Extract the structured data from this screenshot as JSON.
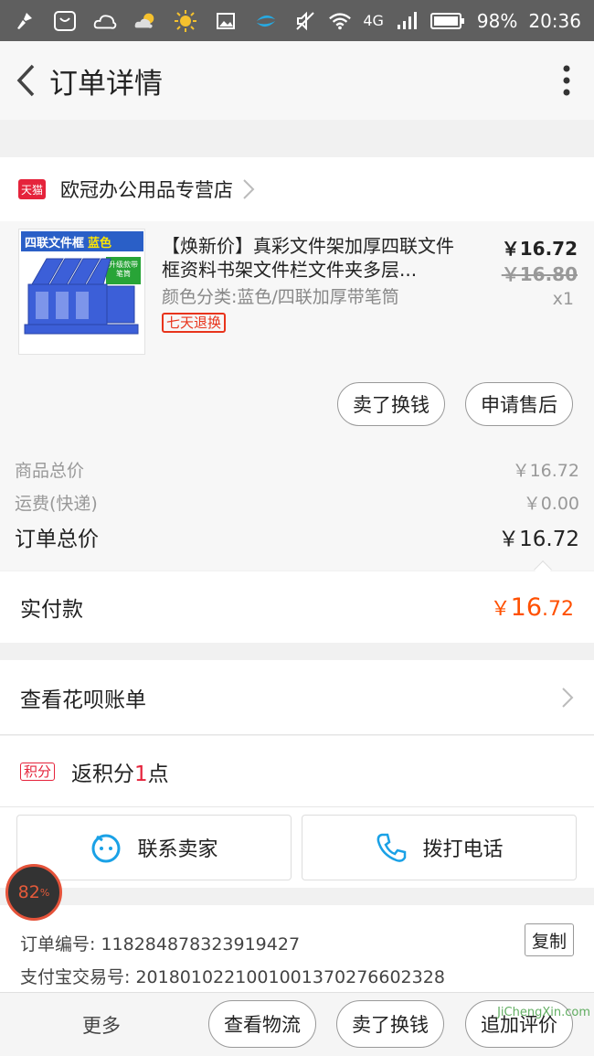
{
  "status": {
    "network": "4G",
    "battery": "98%",
    "time": "20:36"
  },
  "header": {
    "title": "订单详情"
  },
  "store": {
    "badge": "天猫",
    "name": "欧冠办公用品专营店"
  },
  "product": {
    "thumb_title": "四联文件框",
    "thumb_color": "蓝色",
    "thumb_badge": "升级款带笔筒",
    "name": "【焕新价】真彩文件架加厚四联文件框资料书架文件栏文件夹多层...",
    "spec": "颜色分类:蓝色/四联加厚带笔筒",
    "tag": "七天退换",
    "price": "￥16.72",
    "original_price": "￥16.80",
    "quantity": "x1",
    "btn_sell": "卖了换钱",
    "btn_aftersale": "申请售后"
  },
  "summary": {
    "goods_label": "商品总价",
    "goods_value": "￥16.72",
    "shipping_label": "运费(快递)",
    "shipping_value": "￥0.00",
    "total_label": "订单总价",
    "total_value": "￥16.72"
  },
  "paid": {
    "label": "实付款",
    "currency": "￥",
    "integer": "16",
    "decimal": ".72"
  },
  "huabei": {
    "label": "查看花呗账单"
  },
  "points": {
    "badge": "积分",
    "prefix": "返积分",
    "count": "1",
    "suffix": "点"
  },
  "contact": {
    "seller": "联系卖家",
    "call": "拨打电话"
  },
  "order": {
    "number": "订单编号: 118284878323919427",
    "alipay": "支付宝交易号: 2018010221001001370276602328",
    "copy": "复制"
  },
  "bottom": {
    "more": "更多",
    "logistics": "查看物流",
    "sell": "卖了换钱",
    "review": "追加评价"
  },
  "floating": {
    "value": "82",
    "unit": "%"
  },
  "watermark": "JiChengXin.com",
  "colors": {
    "accent": "#ff5000",
    "tmall": "#e5233b"
  }
}
